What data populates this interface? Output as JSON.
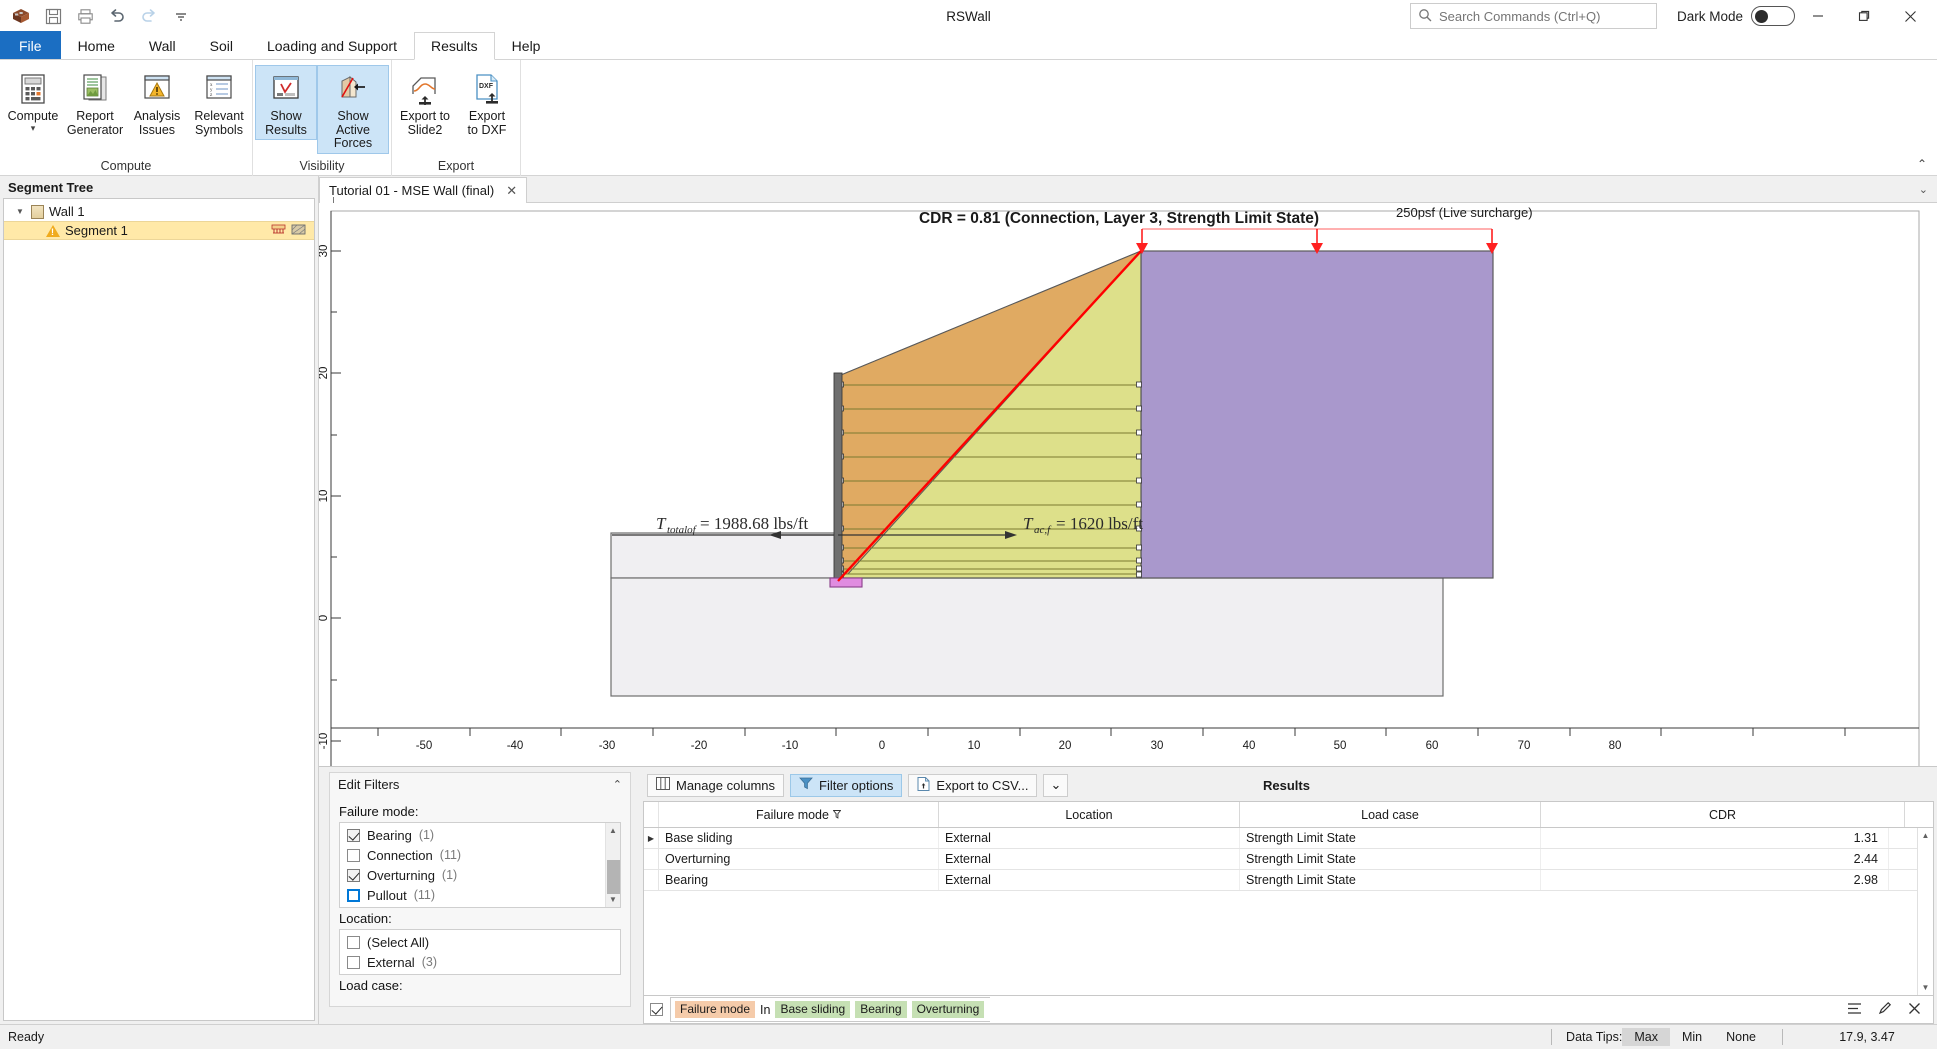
{
  "window": {
    "title": "RSWall",
    "minimize_tooltip": "Minimize",
    "maximize_tooltip": "Restore",
    "close_tooltip": "Close"
  },
  "quick_access": [
    {
      "name": "app-logo-icon",
      "label": "RSWall"
    },
    {
      "name": "save-icon",
      "label": "Save"
    },
    {
      "name": "print-icon",
      "label": "Print"
    },
    {
      "name": "undo-icon",
      "label": "Undo"
    },
    {
      "name": "redo-icon",
      "label": "Redo"
    },
    {
      "name": "customize-qat-icon",
      "label": "Customize Quick Access Toolbar"
    }
  ],
  "search": {
    "placeholder": "Search Commands (Ctrl+Q)",
    "value": "",
    "icon": "search-icon"
  },
  "dark_mode": {
    "label": "Dark Mode",
    "enabled": false
  },
  "ribbon": {
    "tabs": [
      {
        "label": "File",
        "active": false,
        "is_file": true
      },
      {
        "label": "Home",
        "active": false
      },
      {
        "label": "Wall",
        "active": false
      },
      {
        "label": "Soil",
        "active": false
      },
      {
        "label": "Loading and Support",
        "active": false
      },
      {
        "label": "Results",
        "active": true
      },
      {
        "label": "Help",
        "active": false
      }
    ],
    "groups": [
      {
        "label": "Compute",
        "buttons": [
          {
            "label": "Compute",
            "icon": "calculator-icon",
            "selected": false,
            "has_dropdown": true
          },
          {
            "label": "Report\nGenerator",
            "label_line1": "Report",
            "label_line2": "Generator",
            "icon": "report-icon",
            "selected": false
          },
          {
            "label": "Analysis\nIssues",
            "label_line1": "Analysis",
            "label_line2": "Issues",
            "icon": "warning-list-icon",
            "selected": false
          },
          {
            "label": "Relevant\nSymbols",
            "label_line1": "Relevant",
            "label_line2": "Symbols",
            "icon": "symbols-icon",
            "selected": false
          }
        ]
      },
      {
        "label": "Visibility",
        "buttons": [
          {
            "label_line1": "Show",
            "label_line2": "Results",
            "icon": "show-results-icon",
            "selected": true
          },
          {
            "label_line1": "Show Active",
            "label_line2": "Forces",
            "icon": "show-active-forces-icon",
            "selected": true
          }
        ]
      },
      {
        "label": "Export",
        "buttons": [
          {
            "label_line1": "Export to",
            "label_line2": "Slide2",
            "icon": "export-slide2-icon",
            "selected": false
          },
          {
            "label_line1": "Export",
            "label_line2": "to DXF",
            "icon": "export-dxf-icon",
            "selected": false
          }
        ]
      }
    ]
  },
  "segment_tree": {
    "title": "Segment Tree",
    "nodes": [
      {
        "label": "Wall 1",
        "level": 0,
        "expanded": true,
        "icon": "wall-icon"
      },
      {
        "label": "Segment 1",
        "level": 1,
        "selected": true,
        "icon": "warning-icon",
        "trailing_icons": [
          "support-symbol-icon",
          "soil-symbol-icon"
        ]
      }
    ]
  },
  "document_tabs": [
    {
      "label": "Tutorial 01 - MSE Wall (final)",
      "active": true,
      "close_icon": "close-icon"
    }
  ],
  "chart_data": {
    "type": "diagram",
    "title": "CDR = 0.81 (Connection, Layer 3, Strength Limit State)",
    "xlabel": "",
    "ylabel": "",
    "xlim": [
      -57,
      84
    ],
    "ylim": [
      -13,
      33
    ],
    "xticks": [
      -50,
      -40,
      -30,
      -20,
      -10,
      0,
      10,
      20,
      30,
      40,
      50,
      60,
      70,
      80
    ],
    "yticks": [
      30,
      20,
      10,
      0,
      -10
    ],
    "grid": false,
    "annotations": [
      {
        "text": "250psf (Live surcharge)",
        "kind": "surcharge-label"
      },
      {
        "text": "T",
        "sub": "totalof",
        "rest": " = 1988.68 lbs/ft",
        "kind": "force-label-left"
      },
      {
        "text": "T",
        "sub": "ac,f",
        "rest": " = 1620 lbs/ft",
        "kind": "force-label-right"
      }
    ],
    "legend_position": "none",
    "regions": [
      {
        "name": "retained-soil",
        "color": "#a998cc"
      },
      {
        "name": "reinforced-soil",
        "color": "#dde08a"
      },
      {
        "name": "active-wedge",
        "color": "#e0aa62"
      },
      {
        "name": "foundation-soil",
        "color": "#f0eff2"
      },
      {
        "name": "failure-surface",
        "color": "#ff0000"
      },
      {
        "name": "leveling-pad",
        "color": "#e08ce0"
      },
      {
        "name": "wall-facing",
        "color": "#6f6f6f"
      },
      {
        "name": "surcharge-arrows",
        "color": "#ff2020"
      }
    ],
    "reinforcement_layers": 11
  },
  "edit_filters": {
    "title": "Edit Filters",
    "collapse_icon": "chevron-up-icon",
    "sections": [
      {
        "label": "Failure mode:",
        "items": [
          {
            "label": "Bearing",
            "count": "(1)",
            "checked": true,
            "focused": false
          },
          {
            "label": "Connection",
            "count": "(11)",
            "checked": false,
            "focused": false
          },
          {
            "label": "Overturning",
            "count": "(1)",
            "checked": true,
            "focused": false
          },
          {
            "label": "Pullout",
            "count": "(11)",
            "checked": false,
            "focused": true
          }
        ],
        "scrollable": true
      },
      {
        "label": "Location:",
        "items": [
          {
            "label": "(Select All)",
            "count": "",
            "checked": false,
            "focused": false
          },
          {
            "label": "External",
            "count": "(3)",
            "checked": false,
            "focused": false
          }
        ],
        "scrollable": false
      },
      {
        "label": "Load case:",
        "items": [],
        "scrollable": false
      }
    ]
  },
  "results": {
    "toolbar": {
      "title": "Results",
      "manage_columns": "Manage columns",
      "manage_columns_icon": "columns-icon",
      "filter_options": "Filter options",
      "filter_options_icon": "funnel-icon",
      "export_csv": "Export to CSV...",
      "export_csv_icon": "csv-icon",
      "dropdown_icon": "chevron-down-icon"
    },
    "columns": [
      {
        "label": "Failure mode",
        "filtered": true,
        "filter_icon": "funnel-icon",
        "align": "center"
      },
      {
        "label": "Location",
        "filtered": false,
        "align": "center"
      },
      {
        "label": "Load case",
        "filtered": false,
        "align": "center"
      },
      {
        "label": "CDR",
        "filtered": false,
        "align": "center"
      }
    ],
    "rows": [
      {
        "failure_mode": "Base sliding",
        "location": "External",
        "load_case": "Strength Limit State",
        "cdr": "1.31",
        "current": true
      },
      {
        "failure_mode": "Overturning",
        "location": "External",
        "load_case": "Strength Limit State",
        "cdr": "2.44",
        "current": false
      },
      {
        "failure_mode": "Bearing",
        "location": "External",
        "load_case": "Strength Limit State",
        "cdr": "2.98",
        "current": false
      }
    ],
    "filter_bar": {
      "enabled": true,
      "field": "Failure mode",
      "operator": "In",
      "values": [
        "Base sliding",
        "Bearing",
        "Overturning"
      ],
      "menu_icon": "hamburger-icon",
      "edit_icon": "pencil-icon",
      "close_icon": "close-icon"
    }
  },
  "status_bar": {
    "message": "Ready",
    "data_tips_label": "Data Tips:",
    "data_tips_options": [
      {
        "label": "Max",
        "selected": true
      },
      {
        "label": "Min",
        "selected": false
      },
      {
        "label": "None",
        "selected": false
      }
    ],
    "coordinates": "17.9, 3.47"
  }
}
